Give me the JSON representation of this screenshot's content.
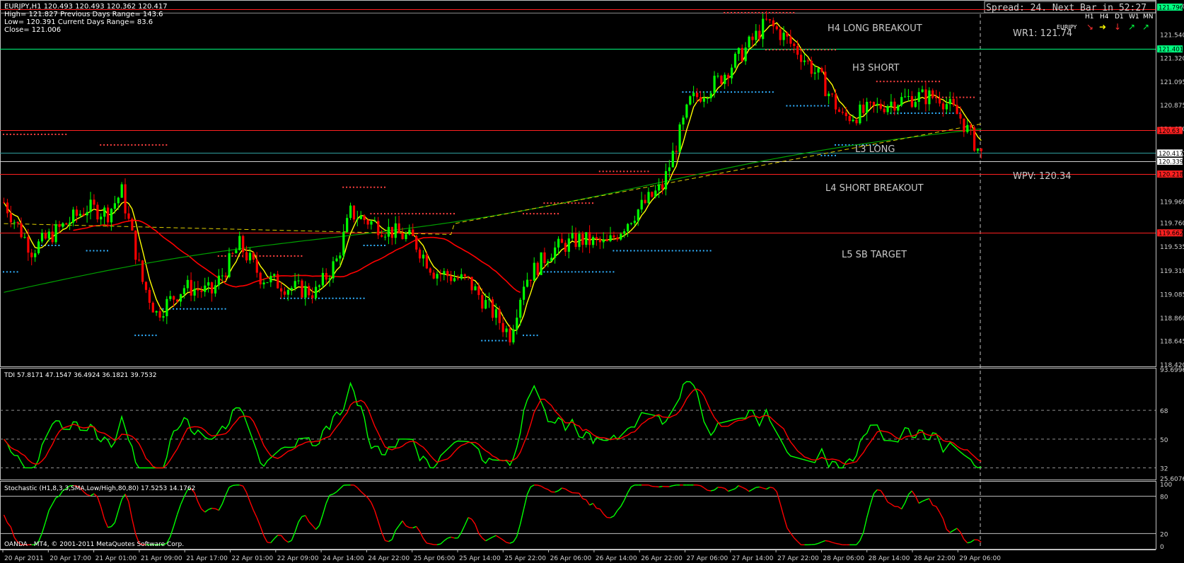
{
  "main_panel": {
    "symbol_line": "EURJPY,H1  120.493 120.493 120.362 120.417",
    "info_line1": "High= 121.827     Previous Days Range= 143.6",
    "info_line2": "Low= 120.391     Current Days Range= 83.6",
    "info_line3": "Close= 121.006",
    "spread_text": "Spread: 24. Next Bar in 52:27",
    "timeframes": [
      "H1",
      "H4",
      "D1",
      "W1",
      "MN"
    ],
    "pair_label": "EURJPY",
    "levels": [
      {
        "label": "H4 LONG BREAKOUT",
        "price": 121.776,
        "color": "#ff2020"
      },
      {
        "label": "H3 SHORT",
        "price": 121.401,
        "color": "#00ff80"
      },
      {
        "label": "L3 LONG",
        "price": 120.63,
        "color": "#ff2020"
      },
      {
        "label": "L4 SHORT BREAKOUT",
        "price": 120.218,
        "color": "#ff2020"
      },
      {
        "label": "L5 SB TARGET",
        "price": 119.662,
        "color": "#ff2020"
      }
    ],
    "wr1_label": "WR1:  121.74",
    "wpv_label": "WPV:  120.34",
    "price_scale": [
      "121.810",
      "121.540",
      "121.320",
      "121.095",
      "120.875",
      "120.650",
      "120.417",
      "119.960",
      "119.760",
      "119.535",
      "119.310",
      "119.085",
      "118.860",
      "118.645",
      "118.420"
    ],
    "price_tags": [
      {
        "text": "121.796",
        "price": 121.796,
        "bg": "#00ff80"
      },
      {
        "text": "121.401",
        "price": 121.401,
        "bg": "#00ff80"
      },
      {
        "text": "120.63",
        "price": 120.63,
        "bg": "#ff2020"
      },
      {
        "text": "120.417",
        "price": 120.417,
        "bg": "#ffffff"
      },
      {
        "text": "120.339",
        "price": 120.339,
        "bg": "#ffffff"
      },
      {
        "text": "120.218",
        "price": 120.218,
        "bg": "#ff2020"
      },
      {
        "text": "119.662",
        "price": 119.662,
        "bg": "#ff2020"
      }
    ],
    "ylim": [
      118.42,
      121.81
    ]
  },
  "tdi_panel": {
    "header": "TDI 57.8171 47.1547 36.4924 36.1821 39.7532",
    "scale": [
      "93.6996",
      "68",
      "50",
      "32",
      "25.6076"
    ]
  },
  "stoch_panel": {
    "header": "Stochastic (H1,8,3,3,SMA,Low/High,80,80) 17.5253 14.1762",
    "scale": [
      "100",
      "80",
      "20",
      "0"
    ],
    "copyright": "OANDA - MT4, © 2001-2011 MetaQuotes Software Corp."
  },
  "time_axis": [
    "20 Apr 2011",
    "20 Apr 17:00",
    "21 Apr 01:00",
    "21 Apr 09:00",
    "21 Apr 17:00",
    "22 Apr 01:00",
    "22 Apr 09:00",
    "24 Apr 14:00",
    "24 Apr 22:00",
    "25 Apr 06:00",
    "25 Apr 14:00",
    "25 Apr 22:00",
    "26 Apr 06:00",
    "26 Apr 14:00",
    "26 Apr 22:00",
    "27 Apr 06:00",
    "27 Apr 14:00",
    "27 Apr 22:00",
    "28 Apr 06:00",
    "28 Apr 14:00",
    "28 Apr 22:00",
    "29 Apr 06:00"
  ],
  "colors": {
    "bull": "#00ff00",
    "bear": "#ff0000",
    "grid": "#c0c0c0",
    "fast_ma": "#ffff00",
    "slow_ma": "#ff0000",
    "long_ma": "#00a000"
  }
}
